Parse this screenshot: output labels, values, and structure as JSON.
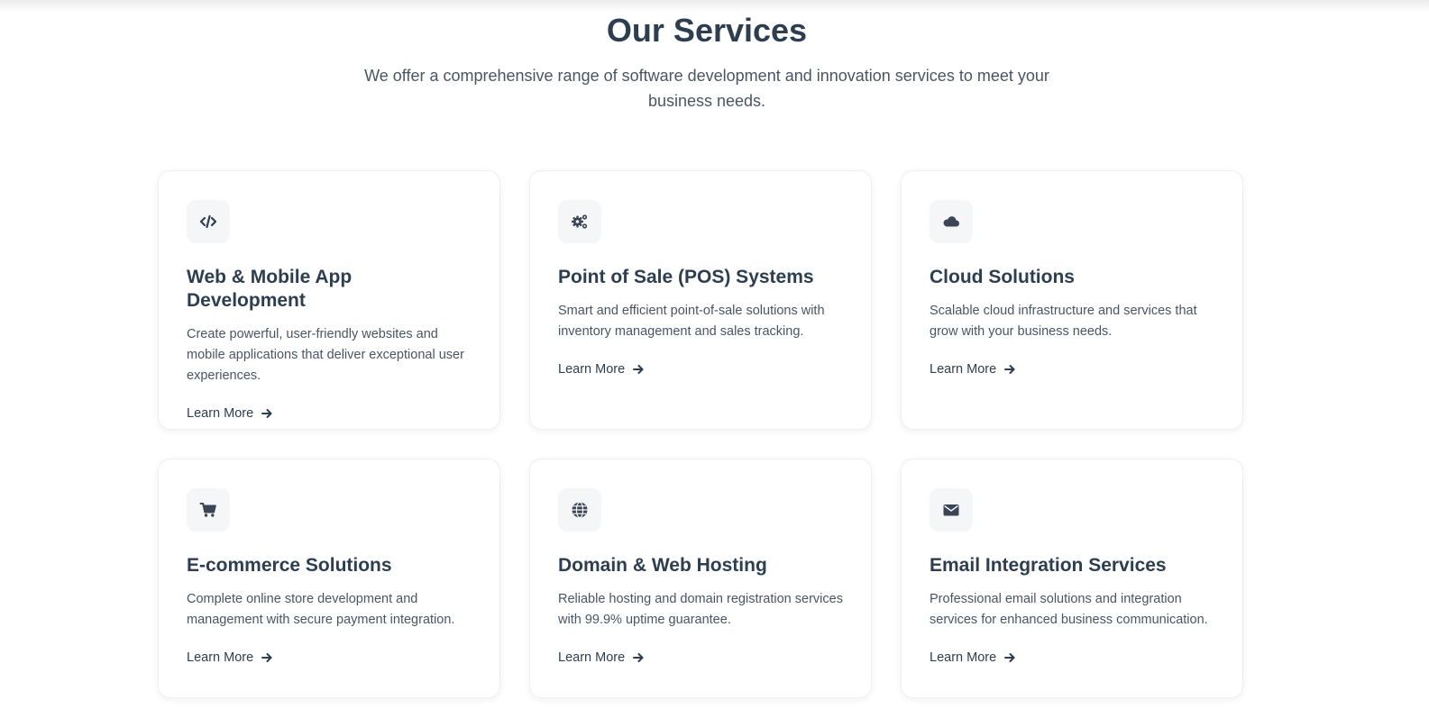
{
  "header": {
    "title": "Our Services",
    "subtitle": "We offer a comprehensive range of software development and innovation services to meet your business needs."
  },
  "colors": {
    "heading": "#2c3e50",
    "body_text": "#4a5563",
    "icon_bg": "#f5f6f8",
    "card_border": "#eef0f3"
  },
  "services": [
    {
      "icon": "code-icon",
      "title": "Web & Mobile App Development",
      "description": "Create powerful, user-friendly websites and mobile applications that deliver exceptional user experiences.",
      "link_label": "Learn More"
    },
    {
      "icon": "gears-icon",
      "title": "Point of Sale (POS) Systems",
      "description": "Smart and efficient point-of-sale solutions with inventory management and sales tracking.",
      "link_label": "Learn More"
    },
    {
      "icon": "cloud-icon",
      "title": "Cloud Solutions",
      "description": "Scalable cloud infrastructure and services that grow with your business needs.",
      "link_label": "Learn More"
    },
    {
      "icon": "shopping-cart-icon",
      "title": "E-commerce Solutions",
      "description": "Complete online store development and management with secure payment integration.",
      "link_label": "Learn More"
    },
    {
      "icon": "globe-icon",
      "title": "Domain & Web Hosting",
      "description": "Reliable hosting and domain registration services with 99.9% uptime guarantee.",
      "link_label": "Learn More"
    },
    {
      "icon": "envelope-icon",
      "title": "Email Integration Services",
      "description": "Professional email solutions and integration services for enhanced business communication.",
      "link_label": "Learn More"
    }
  ]
}
